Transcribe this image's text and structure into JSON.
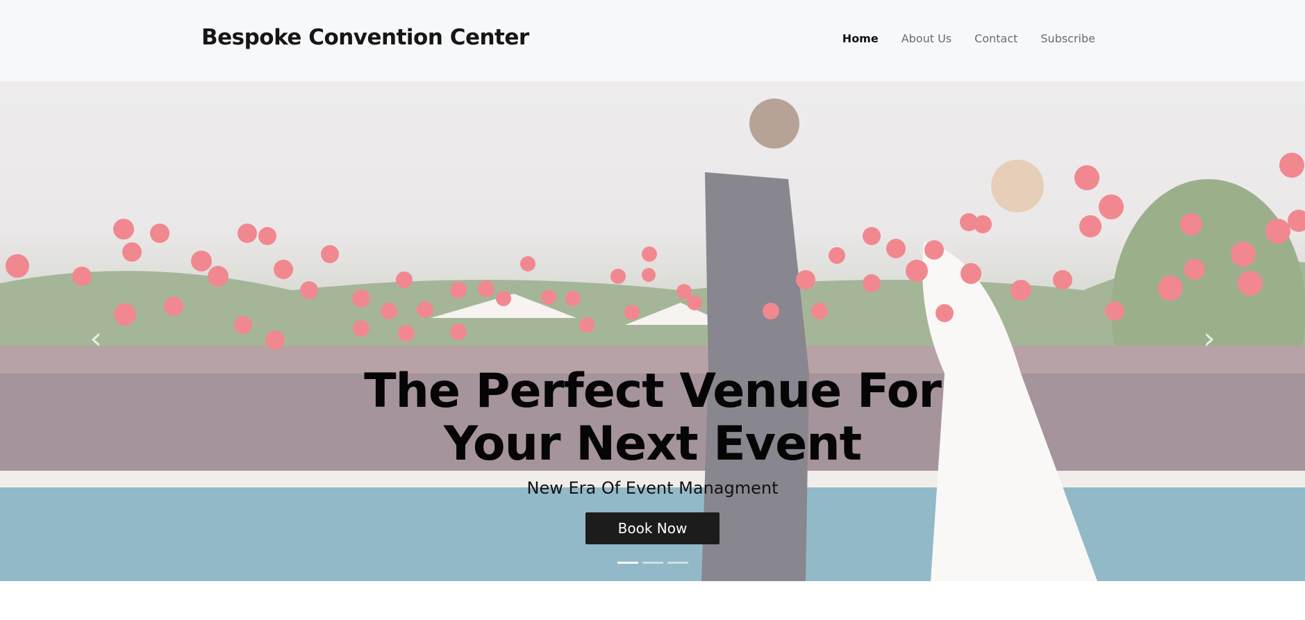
{
  "brand": "Bespoke Convention Center",
  "nav": {
    "items": [
      {
        "label": "Home",
        "active": true
      },
      {
        "label": "About Us",
        "active": false
      },
      {
        "label": "Contact",
        "active": false
      },
      {
        "label": "Subscribe",
        "active": false
      }
    ]
  },
  "hero": {
    "title": "The Perfect Venue For Your Next Event",
    "subtitle": "New Era Of Event Managment",
    "button_label": "Book Now",
    "slides": 3,
    "active_slide": 1,
    "prev_icon": "chevron-left-icon",
    "next_icon": "chevron-right-icon"
  },
  "colors": {
    "navbar_bg": "#f7f8fa",
    "button_bg": "#1c1c1c",
    "balloon": "#e8404c"
  }
}
